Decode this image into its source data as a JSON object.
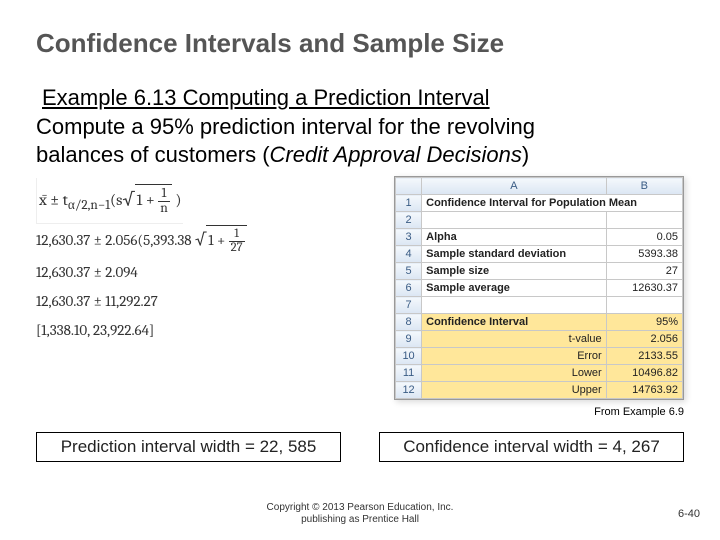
{
  "title": "Confidence Intervals and Sample Size",
  "example_label": "Example 6.13  Computing a Prediction Interval",
  "body_line1": "Compute a 95% prediction interval for the revolving",
  "body_line2a": "balances of customers (",
  "body_line2b": "Credit Approval Decisions",
  "body_line2c": ")",
  "math": {
    "formula_lhs": "x̄ ± t",
    "formula_sub": "α/2,n−1",
    "formula_mid": "(s",
    "formula_inside": "1 + ",
    "formula_frac_n": "1",
    "formula_frac_d": "n",
    "line2a": "12,630.37 ± 2.056(5,393.38",
    "line2_inside_a": "1 + ",
    "line2_frac_n": "1",
    "line2_frac_d": "27",
    "line3": "12,630.37 ± 2.094",
    "line4": "12,630.37 ± 11,292.27",
    "line5": "[1,338.10,    23,922.64]"
  },
  "excel": {
    "colA": "A",
    "colB": "B",
    "r1": "1",
    "r2": "2",
    "r3": "3",
    "r4": "4",
    "r5": "5",
    "r6": "6",
    "r7": "7",
    "r8": "8",
    "r9": "9",
    "r10": "10",
    "r11": "11",
    "r12": "12",
    "a1": "Confidence Interval for Population Mean",
    "a3": "Alpha",
    "b3": "0.05",
    "a4": "Sample standard deviation",
    "b4": "5393.38",
    "a5": "Sample size",
    "b5": "27",
    "a6": "Sample average",
    "b6": "12630.37",
    "a8": "Confidence Interval",
    "b8": "95%",
    "a9": "t-value",
    "b9": "2.056",
    "a10": "Error",
    "b10": "2133.55",
    "a11": "Lower",
    "b11": "10496.82",
    "a12": "Upper",
    "b12": "14763.92"
  },
  "caption": "From  Example 6.9",
  "pred_width": "Prediction interval width = 22, 585",
  "conf_width": "Confidence interval width = 4, 267",
  "copyright1": "Copyright © 2013 Pearson Education, Inc.",
  "copyright2": "publishing as Prentice Hall",
  "pagenum": "6-40"
}
